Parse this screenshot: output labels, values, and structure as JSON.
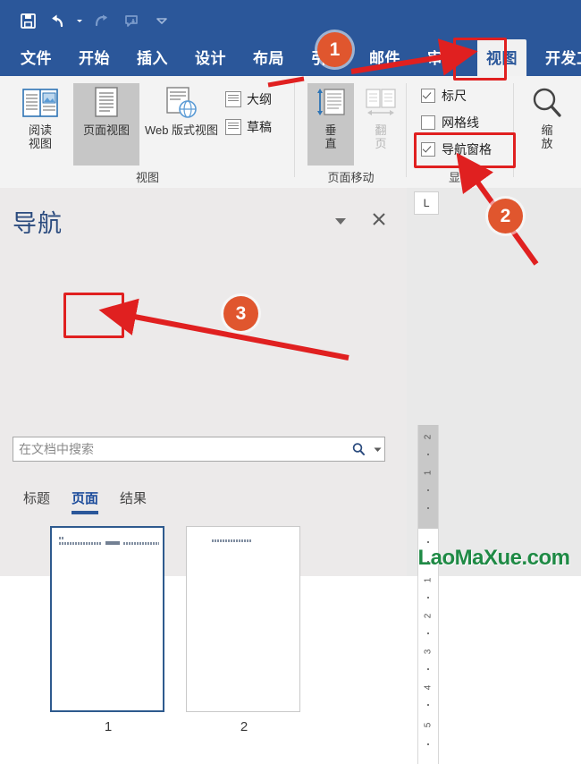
{
  "quick_access": {
    "items": [
      {
        "name": "save-icon",
        "label": "保存",
        "enabled": true
      },
      {
        "name": "undo-icon",
        "label": "撤销",
        "enabled": true
      },
      {
        "name": "redo-icon",
        "label": "恢复",
        "enabled": false
      },
      {
        "name": "touch-mode-icon",
        "label": "触摸/鼠标模式",
        "enabled": false
      },
      {
        "name": "customize-qat-icon",
        "label": "自定义快速访问工具栏",
        "enabled": true
      }
    ]
  },
  "ribbon": {
    "tabs": [
      {
        "label": "文件",
        "active": false
      },
      {
        "label": "开始",
        "active": false
      },
      {
        "label": "插入",
        "active": false
      },
      {
        "label": "设计",
        "active": false
      },
      {
        "label": "布局",
        "active": false
      },
      {
        "label": "引用",
        "active": false
      },
      {
        "label": "邮件",
        "active": false
      },
      {
        "label": "审阅",
        "active": false
      },
      {
        "label": "视图",
        "active": true
      },
      {
        "label": "开发工具",
        "active": false
      }
    ],
    "groups": {
      "views": {
        "label": "视图",
        "buttons": [
          {
            "label": "阅读\n视图",
            "selected": false
          },
          {
            "label": "页面视图",
            "selected": true
          },
          {
            "label": "Web 版式视图",
            "selected": false
          }
        ],
        "small_buttons": [
          {
            "label": "大纲"
          },
          {
            "label": "草稿"
          }
        ]
      },
      "page_movement": {
        "label": "页面移动",
        "buttons": [
          {
            "label": "垂\n直",
            "selected": true,
            "enabled": true
          },
          {
            "label": "翻\n页",
            "selected": false,
            "enabled": false
          }
        ]
      },
      "show": {
        "label": "显示",
        "checkboxes": [
          {
            "label": "标尺",
            "checked": true,
            "highlighted": false
          },
          {
            "label": "网格线",
            "checked": false,
            "highlighted": false
          },
          {
            "label": "导航窗格",
            "checked": true,
            "highlighted": true
          }
        ]
      },
      "zoom": {
        "label": "",
        "buttons": [
          {
            "label": "缩\n放",
            "selected": false
          }
        ]
      }
    }
  },
  "navigation_pane": {
    "title": "导航",
    "caret_icon": "chevron-down-icon",
    "close_icon": "close-icon",
    "search": {
      "placeholder": "在文档中搜索",
      "value": "",
      "search_icon": "search-icon",
      "dropdown_icon": "chevron-down-icon"
    },
    "tabs": [
      {
        "label": "标题",
        "active": false
      },
      {
        "label": "页面",
        "active": true
      },
      {
        "label": "结果",
        "active": false
      }
    ],
    "thumbnails": [
      {
        "number": "1",
        "selected": true
      },
      {
        "number": "2",
        "selected": false
      }
    ]
  },
  "document_area": {
    "tab_stop_marker": "L",
    "ruler": {
      "margin_labels": [
        "2",
        "1"
      ],
      "body_labels": [
        "1",
        "2",
        "3",
        "4",
        "5"
      ]
    }
  },
  "annotations": {
    "badges": [
      {
        "number": "1"
      },
      {
        "number": "2"
      },
      {
        "number": "3"
      }
    ],
    "accent_color": "#e02020",
    "badge_color": "#e0562e"
  },
  "watermark": {
    "text": "LaoMaXue.com",
    "color": "#1f8a45"
  }
}
